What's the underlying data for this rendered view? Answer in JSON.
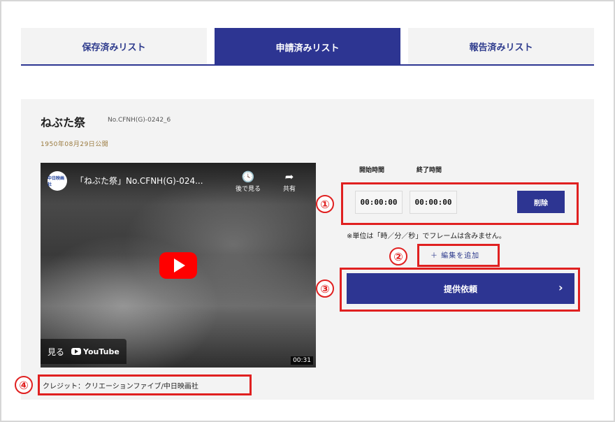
{
  "tabs": [
    {
      "label": "保存済みリスト",
      "active": false
    },
    {
      "label": "申請済みリスト",
      "active": true
    },
    {
      "label": "報告済みリスト",
      "active": false
    }
  ],
  "item": {
    "title": "ねぶた祭",
    "code": "No.CFNH(G)-0242_6",
    "published": "1950年08月29日公開"
  },
  "video": {
    "channel_logo": "中日映画社",
    "title": "「ねぶた祭」No.CFNH(G)-024...",
    "watch_later_label": "後で見る",
    "watch_later_icon": "clock-icon",
    "share_label": "共有",
    "share_icon": "share-arrow-icon",
    "watch_label": "見る",
    "youtube_label": "YouTube",
    "duration": "00:31"
  },
  "times": {
    "start_label": "開始時間",
    "end_label": "終了時間",
    "start_value": "00:00:00",
    "end_value": "00:00:00",
    "delete_label": "削除",
    "note": "※単位は「時／分／秒」でフレームは含みません。"
  },
  "add_edit_label": "＋ 編集を追加",
  "request_label": "提供依頼",
  "request_arrow": "›",
  "credit": "クレジット：クリエーションファイブ/中日映画社",
  "annotations": [
    "①",
    "②",
    "③",
    "④"
  ],
  "colors": {
    "primary": "#2d3592",
    "highlight": "#e02020",
    "card_bg": "#f3f3f3",
    "date": "#9a7a3e"
  }
}
